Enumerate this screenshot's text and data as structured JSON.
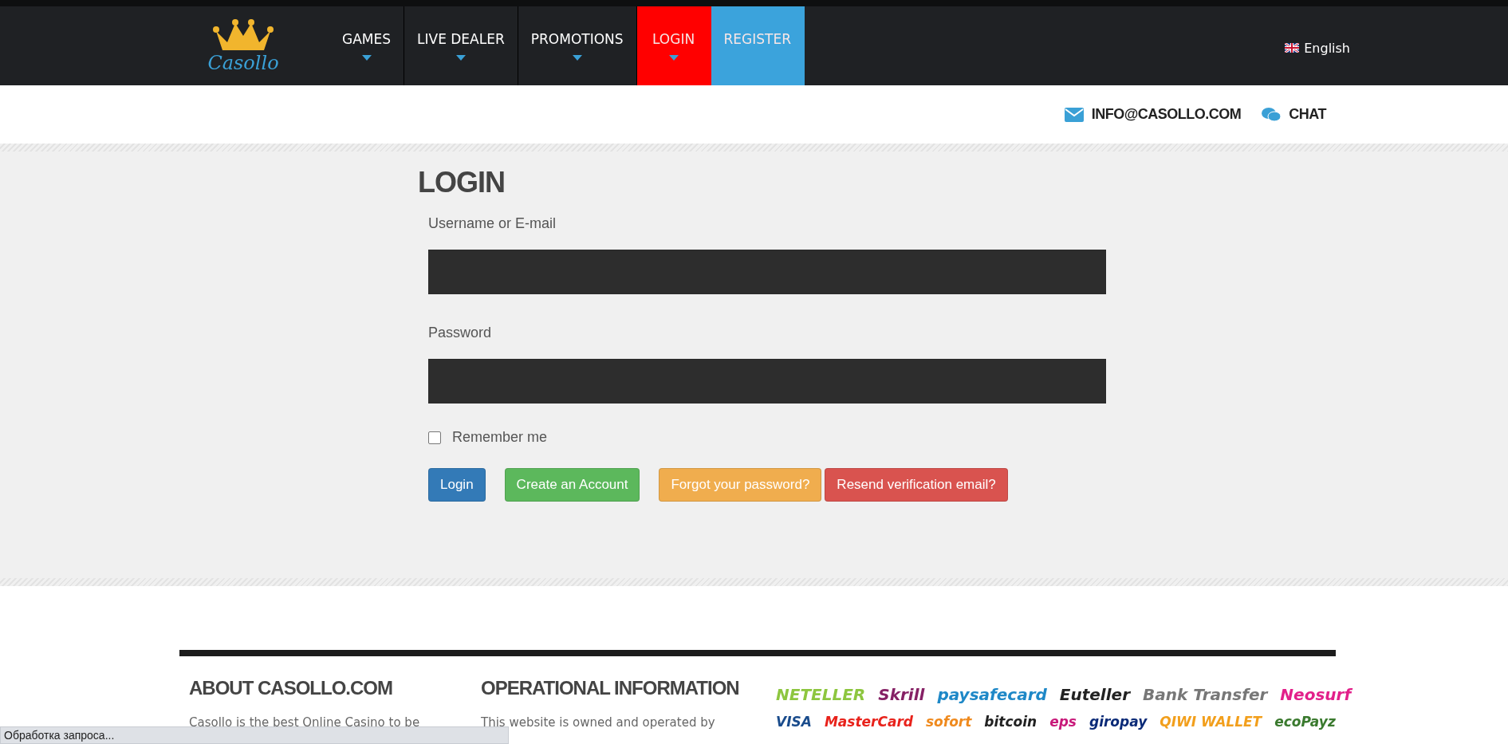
{
  "header": {
    "logo": "Casollo",
    "nav": [
      {
        "label": "GAMES",
        "dropdown": true
      },
      {
        "label": "LIVE DEALER",
        "dropdown": true
      },
      {
        "label": "PROMOTIONS",
        "dropdown": true
      },
      {
        "label": "LOGIN",
        "dropdown": true,
        "color": "#ff0000"
      },
      {
        "label": "REGISTER",
        "dropdown": false,
        "color": "#3ba3dc"
      }
    ],
    "language": "English"
  },
  "contact": {
    "email": "INFO@CASOLLO.COM",
    "chat": "CHAT"
  },
  "login": {
    "title": "LOGIN",
    "fields": [
      {
        "label": "Username or E-mail"
      },
      {
        "label": "Password"
      }
    ],
    "remember": {
      "label": "Remember me",
      "checked": false
    },
    "buttons": [
      {
        "label": "Login",
        "color": "#337ab7"
      },
      {
        "label": "Create an Account",
        "color": "#5cb85c"
      },
      {
        "label": "Forgot your password?",
        "color": "#f0ad4e"
      },
      {
        "label": "Resend verification email?",
        "color": "#d9534f"
      }
    ]
  },
  "footer": {
    "columns": [
      {
        "title": "ABOUT CASOLLO.COM",
        "text": "Casollo is the best Online Casino to be"
      },
      {
        "title": "OPERATIONAL INFORMATION",
        "text": "This website is owned and operated by"
      }
    ],
    "payments": [
      [
        {
          "label": "NETELLER",
          "color": "#8dc63f"
        },
        {
          "label": "Skrill",
          "color": "#862165"
        },
        {
          "label": "paysafecard",
          "color": "#1e88c7"
        },
        {
          "label": "Euteller",
          "color": "#222222"
        },
        {
          "label": "Bank Transfer",
          "color": "#777777"
        },
        {
          "label": "Neosurf",
          "color": "#e2208a"
        }
      ],
      [
        {
          "label": "VISA",
          "color": "#1a4c8c"
        },
        {
          "label": "MasterCard",
          "color": "#e8221b"
        },
        {
          "label": "sofort",
          "color": "#ef8a1e"
        },
        {
          "label": "bitcoin",
          "color": "#222222"
        },
        {
          "label": "eps",
          "color": "#c8197a"
        },
        {
          "label": "giropay",
          "color": "#0a2a77"
        },
        {
          "label": "QIWI WALLET",
          "color": "#f29f1c"
        },
        {
          "label": "ecoPayz",
          "color": "#3a7a2e"
        }
      ]
    ]
  },
  "status_bar": {
    "text": "Обработка запроса..."
  }
}
